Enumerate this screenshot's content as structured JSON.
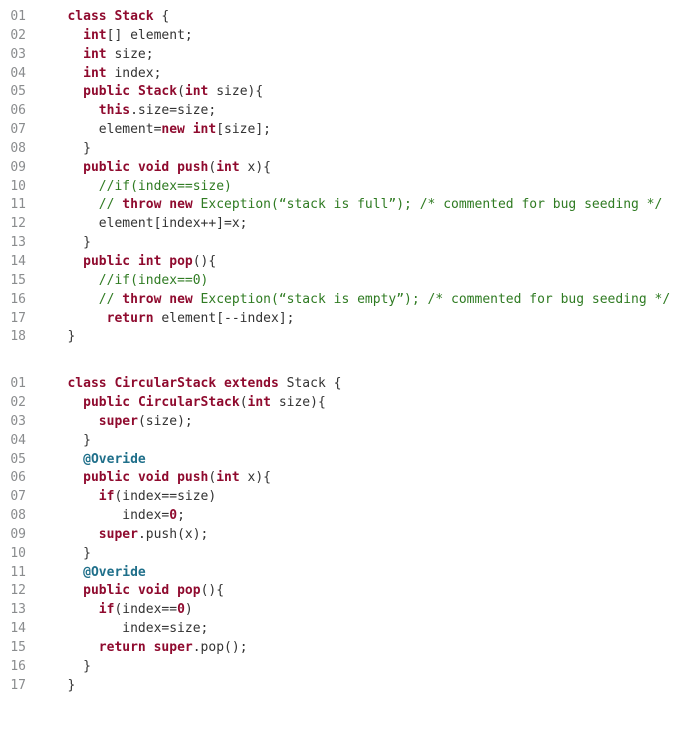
{
  "block1": {
    "lines": [
      {
        "n": "01",
        "seg": [
          [
            "plain",
            "   "
          ],
          [
            "kw",
            "class"
          ],
          [
            "plain",
            " "
          ],
          [
            "cname",
            "Stack"
          ],
          [
            "plain",
            " {"
          ]
        ]
      },
      {
        "n": "02",
        "seg": [
          [
            "plain",
            "     "
          ],
          [
            "kw",
            "int"
          ],
          [
            "plain",
            "[] element;"
          ]
        ]
      },
      {
        "n": "03",
        "seg": [
          [
            "plain",
            "     "
          ],
          [
            "kw",
            "int"
          ],
          [
            "plain",
            " size;"
          ]
        ]
      },
      {
        "n": "04",
        "seg": [
          [
            "plain",
            "     "
          ],
          [
            "kw",
            "int"
          ],
          [
            "plain",
            " index;"
          ]
        ]
      },
      {
        "n": "05",
        "seg": [
          [
            "plain",
            "     "
          ],
          [
            "kw",
            "public"
          ],
          [
            "plain",
            " "
          ],
          [
            "cname",
            "Stack"
          ],
          [
            "plain",
            "("
          ],
          [
            "kw",
            "int"
          ],
          [
            "plain",
            " size){"
          ]
        ]
      },
      {
        "n": "06",
        "seg": [
          [
            "plain",
            "       "
          ],
          [
            "kw",
            "this"
          ],
          [
            "plain",
            ".size=size;"
          ]
        ]
      },
      {
        "n": "07",
        "seg": [
          [
            "plain",
            "       element="
          ],
          [
            "kw",
            "new"
          ],
          [
            "plain",
            " "
          ],
          [
            "kw",
            "int"
          ],
          [
            "plain",
            "[size];"
          ]
        ]
      },
      {
        "n": "08",
        "seg": [
          [
            "plain",
            "     }"
          ]
        ]
      },
      {
        "n": "09",
        "seg": [
          [
            "plain",
            "     "
          ],
          [
            "kw",
            "public"
          ],
          [
            "plain",
            " "
          ],
          [
            "kw",
            "void"
          ],
          [
            "plain",
            " "
          ],
          [
            "mname",
            "push"
          ],
          [
            "plain",
            "("
          ],
          [
            "kw",
            "int"
          ],
          [
            "plain",
            " x){"
          ]
        ]
      },
      {
        "n": "10",
        "seg": [
          [
            "plain",
            "       "
          ],
          [
            "comment",
            "//if(index==size)"
          ]
        ]
      },
      {
        "n": "11",
        "seg": [
          [
            "plain",
            "       "
          ],
          [
            "comment",
            "// "
          ],
          [
            "kw",
            "throw new"
          ],
          [
            "comment",
            " Exception(“stack is full”); /* commented for bug seeding */"
          ]
        ]
      },
      {
        "n": "12",
        "seg": [
          [
            "plain",
            "       element[index++]=x;"
          ]
        ]
      },
      {
        "n": "13",
        "seg": [
          [
            "plain",
            "     }"
          ]
        ]
      },
      {
        "n": "14",
        "seg": [
          [
            "plain",
            "     "
          ],
          [
            "kw",
            "public"
          ],
          [
            "plain",
            " "
          ],
          [
            "kw",
            "int"
          ],
          [
            "plain",
            " "
          ],
          [
            "mname",
            "pop"
          ],
          [
            "plain",
            "(){"
          ]
        ]
      },
      {
        "n": "15",
        "seg": [
          [
            "plain",
            "       "
          ],
          [
            "comment",
            "//if(index==0)"
          ]
        ]
      },
      {
        "n": "16",
        "seg": [
          [
            "plain",
            "       "
          ],
          [
            "comment",
            "// "
          ],
          [
            "kw",
            "throw new"
          ],
          [
            "comment",
            " Exception(“stack is empty”); /* commented for bug seeding */"
          ]
        ]
      },
      {
        "n": "17",
        "seg": [
          [
            "plain",
            "        "
          ],
          [
            "kw",
            "return"
          ],
          [
            "plain",
            " element[--index];"
          ]
        ]
      },
      {
        "n": "18",
        "seg": [
          [
            "plain",
            "   }"
          ]
        ]
      }
    ]
  },
  "block2": {
    "lines": [
      {
        "n": "01",
        "seg": [
          [
            "plain",
            "   "
          ],
          [
            "kw",
            "class"
          ],
          [
            "plain",
            " "
          ],
          [
            "cname",
            "CircularStack"
          ],
          [
            "plain",
            " "
          ],
          [
            "kw",
            "extends"
          ],
          [
            "plain",
            " Stack {"
          ]
        ]
      },
      {
        "n": "02",
        "seg": [
          [
            "plain",
            "     "
          ],
          [
            "kw",
            "public"
          ],
          [
            "plain",
            " "
          ],
          [
            "cname",
            "CircularStack"
          ],
          [
            "plain",
            "("
          ],
          [
            "kw",
            "int"
          ],
          [
            "plain",
            " size){"
          ]
        ]
      },
      {
        "n": "03",
        "seg": [
          [
            "plain",
            "       "
          ],
          [
            "kw",
            "super"
          ],
          [
            "plain",
            "(size);"
          ]
        ]
      },
      {
        "n": "04",
        "seg": [
          [
            "plain",
            "     }"
          ]
        ]
      },
      {
        "n": "05",
        "seg": [
          [
            "plain",
            "     "
          ],
          [
            "ann",
            "@Overide"
          ]
        ]
      },
      {
        "n": "06",
        "seg": [
          [
            "plain",
            "     "
          ],
          [
            "kw",
            "public"
          ],
          [
            "plain",
            " "
          ],
          [
            "kw",
            "void"
          ],
          [
            "plain",
            " "
          ],
          [
            "mname",
            "push"
          ],
          [
            "plain",
            "("
          ],
          [
            "kw",
            "int"
          ],
          [
            "plain",
            " x){"
          ]
        ]
      },
      {
        "n": "07",
        "seg": [
          [
            "plain",
            "       "
          ],
          [
            "kw",
            "if"
          ],
          [
            "plain",
            "(index==size)"
          ]
        ]
      },
      {
        "n": "08",
        "seg": [
          [
            "plain",
            "          index="
          ],
          [
            "num",
            "0"
          ],
          [
            "plain",
            ";"
          ]
        ]
      },
      {
        "n": "09",
        "seg": [
          [
            "plain",
            "       "
          ],
          [
            "kw",
            "super"
          ],
          [
            "plain",
            ".push(x);"
          ]
        ]
      },
      {
        "n": "10",
        "seg": [
          [
            "plain",
            "     }"
          ]
        ]
      },
      {
        "n": "11",
        "seg": [
          [
            "plain",
            "     "
          ],
          [
            "ann",
            "@Overide"
          ]
        ]
      },
      {
        "n": "12",
        "seg": [
          [
            "plain",
            "     "
          ],
          [
            "kw",
            "public"
          ],
          [
            "plain",
            " "
          ],
          [
            "kw",
            "void"
          ],
          [
            "plain",
            " "
          ],
          [
            "mname",
            "pop"
          ],
          [
            "plain",
            "(){"
          ]
        ]
      },
      {
        "n": "13",
        "seg": [
          [
            "plain",
            "       "
          ],
          [
            "kw",
            "if"
          ],
          [
            "plain",
            "(index=="
          ],
          [
            "num",
            "0"
          ],
          [
            "plain",
            ")"
          ]
        ]
      },
      {
        "n": "14",
        "seg": [
          [
            "plain",
            "          index=size;"
          ]
        ]
      },
      {
        "n": "15",
        "seg": [
          [
            "plain",
            "       "
          ],
          [
            "kw",
            "return"
          ],
          [
            "plain",
            " "
          ],
          [
            "kw",
            "super"
          ],
          [
            "plain",
            ".pop();"
          ]
        ]
      },
      {
        "n": "16",
        "seg": [
          [
            "plain",
            "     }"
          ]
        ]
      },
      {
        "n": "17",
        "seg": [
          [
            "plain",
            "   }"
          ]
        ]
      }
    ]
  }
}
